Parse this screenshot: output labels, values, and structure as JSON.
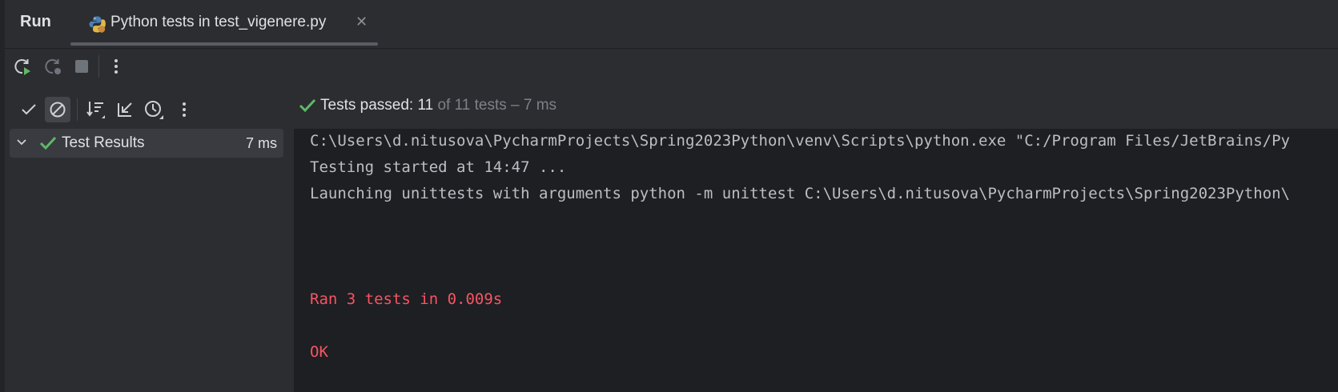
{
  "tabbar": {
    "run_label": "Run",
    "tab_title": "Python tests in test_vigenere.py",
    "tab_icon": "python-icon",
    "close_glyph": "✕"
  },
  "run_toolbar": {
    "icons": [
      "rerun-icon",
      "rerun-failed-icon",
      "stop-icon",
      "more-options-icon"
    ]
  },
  "test_toolbar": {
    "icons": [
      "show-passed-icon",
      "show-ignored-icon",
      "sort-icon",
      "collapse-icon",
      "test-history-icon",
      "more-options-icon"
    ]
  },
  "tree": {
    "root_label": "Test Results",
    "root_time": "7 ms"
  },
  "status": {
    "passed_label": "Tests passed: 11",
    "summary": " of 11 tests – 7 ms"
  },
  "console": {
    "lines": [
      "C:\\Users\\d.nitusova\\PycharmProjects\\Spring2023Python\\venv\\Scripts\\python.exe \"C:/Program Files/JetBrains/Py",
      "Testing started at 14:47 ...",
      "Launching unittests with arguments python -m unittest C:\\Users\\d.nitusova\\PycharmProjects\\Spring2023Python\\",
      "Ran 3 tests in 0.009s",
      "OK"
    ]
  },
  "colors": {
    "background": "#2b2d30",
    "console_bg": "#1e1f22",
    "success_green": "#5fb865",
    "error_red": "#f75464",
    "run_green": "#5fb865"
  }
}
